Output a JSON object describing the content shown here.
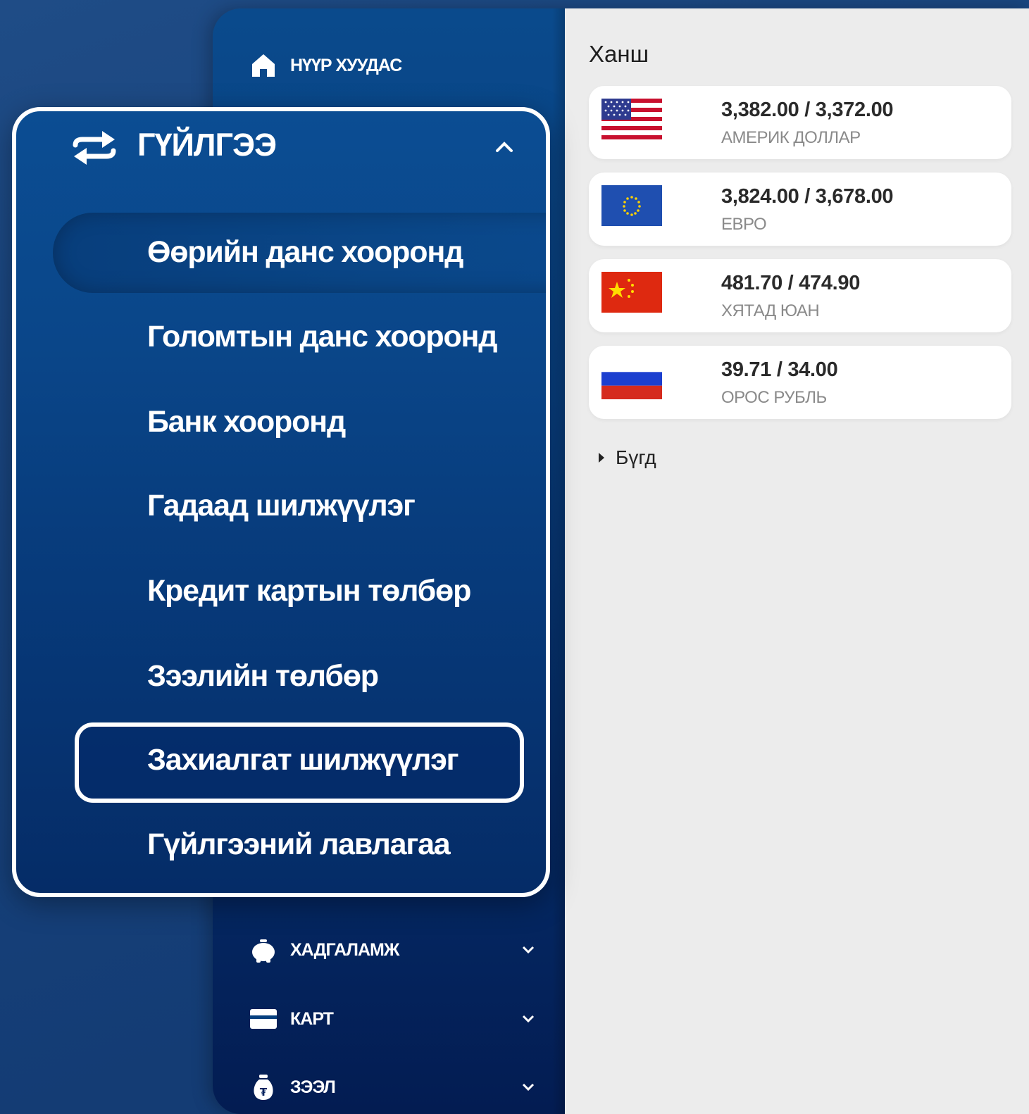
{
  "sidebar": {
    "home_label": "НҮҮР ХУУДАС",
    "savings_label": "ХАДГАЛАМЖ",
    "card_label": "КАРТ",
    "loan_label": "ЗЭЭЛ"
  },
  "transactions_menu": {
    "title": "ГҮЙЛГЭЭ",
    "items": [
      "Өөрийн данс хооронд",
      "Голомтын данс хооронд",
      "Банк хооронд",
      "Гадаад шилжүүлэг",
      "Кредит картын төлбөр",
      "Зээлийн төлбөр",
      "Захиалгат шилжүүлэг",
      "Гүйлгээний лавлагаа"
    ],
    "highlighted_item": "Захиалгат шилжүүлэг"
  },
  "rates": {
    "title": "Ханш",
    "items": [
      {
        "values": "3,382.00 / 3,372.00",
        "name": "АМЕРИК ДОЛЛАР",
        "flag_icon": "us-flag-icon"
      },
      {
        "values": "3,824.00 / 3,678.00",
        "name": "ЕВРО",
        "flag_icon": "eu-flag-icon"
      },
      {
        "values": "481.70 / 474.90",
        "name": "ХЯТАД ЮАН",
        "flag_icon": "china-flag-icon"
      },
      {
        "values": "39.71 / 34.00",
        "name": "ОРОС РУБЛЬ",
        "flag_icon": "russia-flag-icon"
      }
    ],
    "all_label": "Бүгд"
  },
  "colors": {
    "sidebar_blue": "#083f80",
    "main_bg": "#ececec",
    "card_bg": "#ffffff",
    "highlight_border": "#ffffff"
  }
}
